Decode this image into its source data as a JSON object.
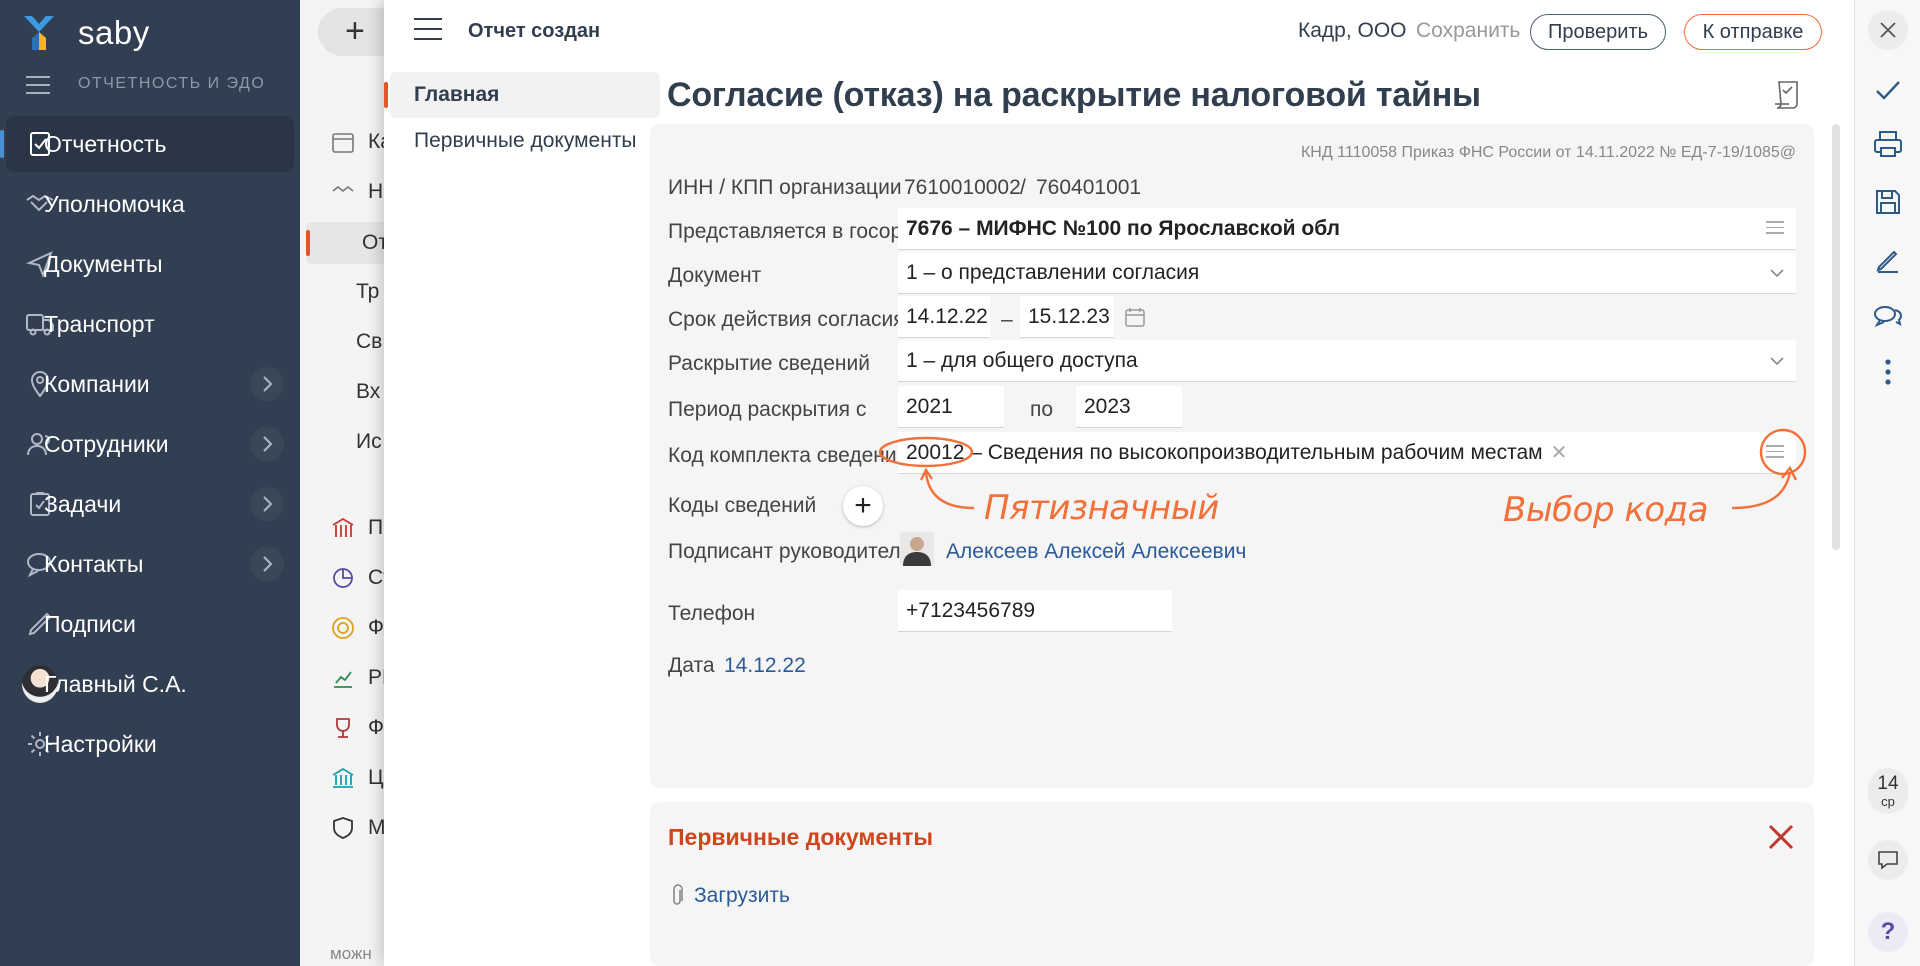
{
  "nav": {
    "brand": "saby",
    "section": "ОТЧЕТНОСТЬ И ЭДО",
    "items": [
      {
        "label": "Отчетность"
      },
      {
        "label": "Уполномочка"
      },
      {
        "label": "Документы"
      },
      {
        "label": "Транспорт"
      },
      {
        "label": "Компании"
      },
      {
        "label": "Сотрудники"
      },
      {
        "label": "Задачи"
      },
      {
        "label": "Контакты"
      },
      {
        "label": "Подписи"
      },
      {
        "label": "Главный С.А."
      },
      {
        "label": "Настройки"
      }
    ]
  },
  "col2": {
    "plus": "+",
    "rows": [
      "Ка",
      "На",
      "От",
      "Тр",
      "Св",
      "Вх",
      "Ис",
      "Пе",
      "Ст",
      "Фо",
      "РГ",
      "Фо",
      "ЦБ",
      "МІ"
    ],
    "footer": "можн"
  },
  "header": {
    "status": "Отчет создан",
    "org": "Кадр, ООО",
    "save": "Сохранить",
    "check": "Проверить",
    "send": "К отправке"
  },
  "tabs": [
    "Главная",
    "Первичные документы"
  ],
  "title": "Согласие (отказ) на раскрытие налоговой тайны",
  "form": {
    "knd": "КНД 1110058 Приказ ФНС России от 14.11.2022 № ЕД-7-19/1085@",
    "inn_label": "ИНН / КПП организации",
    "inn": "7610010002",
    "inn_sep": "/",
    "kpp": "760401001",
    "org_label": "Представляется в госорган",
    "org_value": "7676 – МИФНС №100 по Ярославской обл",
    "doc_label": "Документ",
    "doc_value": "1 – о представлении согласия",
    "term_label": "Срок действия согласия",
    "term_from": "14.12.22",
    "term_dash": "–",
    "term_to": "15.12.23",
    "disclose_label": "Раскрытие сведений",
    "disclose_value": "1 – для общего доступа",
    "period_label": "Период раскрытия с",
    "period_from": "2021",
    "period_to_label": "по",
    "period_to": "2023",
    "code_label": "Код комплекта сведений",
    "code_value": "20012 – Сведения по высокопроизводительным рабочим местам",
    "codes_label": "Коды сведений",
    "signer_label": "Подписант руководитель",
    "signer_name": "Алексеев Алексей Алексеевич",
    "phone_label": "Телефон",
    "phone_value": "+7123456789",
    "date_label": "Дата",
    "date_value": "14.12.22"
  },
  "annotations": {
    "five_digit": "Пятизначный",
    "choose_code": "Выбор кода",
    "color": "#f2713a"
  },
  "primary": {
    "title": "Первичные документы",
    "upload": "Загрузить"
  },
  "rbar": {
    "day": "14",
    "weekday": "ср",
    "help": "?"
  },
  "colors": {
    "sidebar": "#323e51",
    "accent": "#e8542a",
    "link": "#2a5a9a",
    "section_title": "#d0451b"
  }
}
